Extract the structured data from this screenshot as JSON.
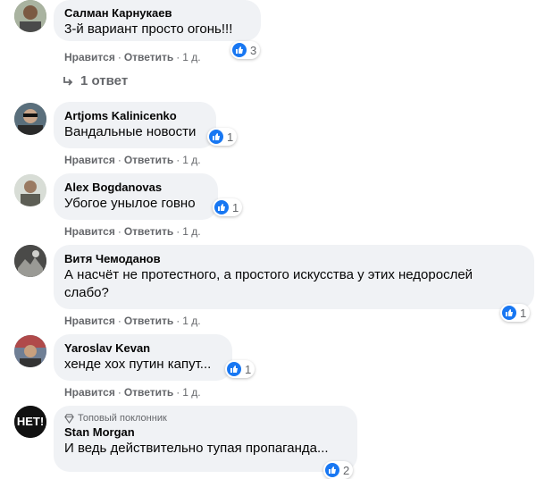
{
  "actions": {
    "like": "Нравится",
    "reply": "Ответить",
    "dot": "·"
  },
  "comments": [
    {
      "author": "Салман Карнукаев",
      "text": "3-й вариант просто огонь!!!",
      "likes": "3",
      "time": "1 д.",
      "replies": "1 ответ"
    },
    {
      "author": "Artjoms Kalinicenko",
      "text": "Вандальные новости",
      "likes": "1",
      "time": "1 д."
    },
    {
      "author": "Alex Bogdanovas",
      "text": "Убогое унылое говно",
      "likes": "1",
      "time": "1 д."
    },
    {
      "author": "Витя Чемоданов",
      "text": "А насчёт не протестного, а простого искусства у этих недорослей\nслабо?",
      "likes": "1",
      "time": "1 д."
    },
    {
      "author": "Yaroslav Kevan",
      "text": "хенде хох путин капут...",
      "likes": "1",
      "time": "1 д."
    },
    {
      "badge": "Топовый поклонник",
      "author": "Stan Morgan",
      "text": "И ведь действительно тупая пропаганда...",
      "likes": "2",
      "avatar_text": "НЕТ!"
    }
  ],
  "colors": {
    "bubble": "#f0f2f5",
    "like_blue": "#1877f2",
    "meta": "#65676b"
  }
}
